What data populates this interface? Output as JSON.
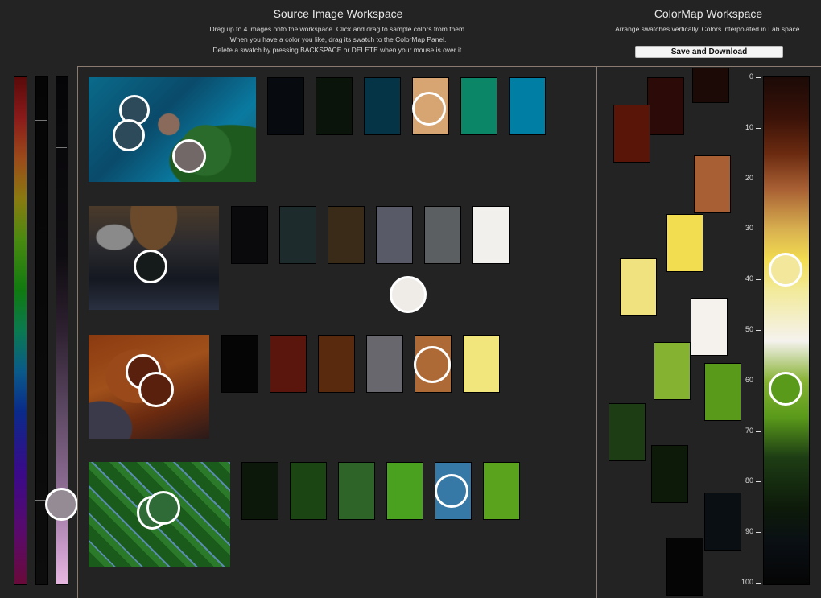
{
  "source_workspace": {
    "title": "Source Image Workspace",
    "instructions": [
      "Drag up to 4 images onto the workspace.  Click and drag to sample colors from them.",
      "When you have a color you like, drag its swatch to the ColorMap Panel.",
      "Delete a swatch by pressing BACKSPACE or DELETE when your mouse is over it."
    ]
  },
  "colormap_workspace": {
    "title": "ColorMap Workspace",
    "instructions": "Arrange swatches vertically. Colors interpolated in Lab space.",
    "save_label": "Save and Download"
  },
  "image_rows": [
    {
      "image": "coastal-island",
      "swatches": [
        "#070b10",
        "#0b140b",
        "#053447",
        "#d6a572",
        "#0b8667",
        "#017ea4"
      ]
    },
    {
      "image": "cloudy-earth",
      "swatches": [
        "#0a0a0c",
        "#1e2b2c",
        "#3a2a18",
        "#595a68",
        "#5c5f62",
        "#f2f0ec"
      ]
    },
    {
      "image": "desert",
      "swatches": [
        "#050505",
        "#5a150c",
        "#5a2a0e",
        "#67676d",
        "#ae6a36",
        "#f1e67c"
      ]
    },
    {
      "image": "leaves",
      "swatches": [
        "#0c180a",
        "#1c4514",
        "#2f6428",
        "#4aa11f",
        "#3779a6",
        "#5aa31c"
      ]
    }
  ],
  "colormap_swatches": [
    "#1c0a07",
    "#2c0a08",
    "#5a1509",
    "#a85f33",
    "#f2dc50",
    "#f0e27e",
    "#f5f2ee",
    "#86b232",
    "#5a9a1a",
    "#1d3d14",
    "#0d1a0a",
    "#0a0f14",
    "#050505"
  ],
  "colormap_ticks": [
    "0",
    "10",
    "20",
    "30",
    "40",
    "50",
    "60",
    "70",
    "80",
    "90",
    "100"
  ],
  "colors": {
    "background": "#232323",
    "panel_border": "#8a7a70",
    "circle": "#ffffff"
  }
}
